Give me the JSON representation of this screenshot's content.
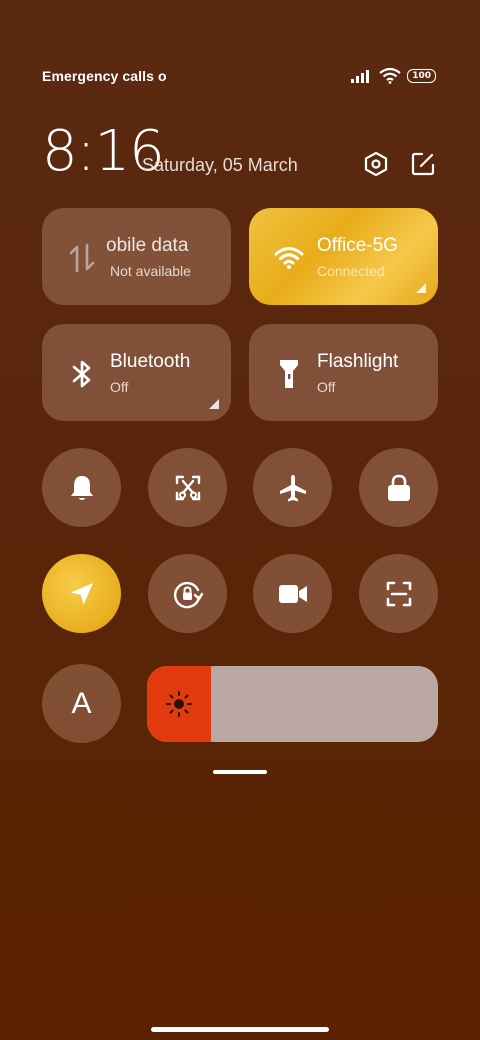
{
  "status_bar": {
    "carrier_text": "Emergency calls o",
    "battery_level": "100",
    "icons": [
      "signal-icon",
      "wifi-icon",
      "battery-icon"
    ]
  },
  "header": {
    "time": "8:16",
    "date": "Saturday, 05 March",
    "icons": [
      "settings-icon",
      "edit-icon"
    ]
  },
  "tiles": {
    "mobile_data": {
      "title": "obile data",
      "subtitle": "Not available",
      "active": false
    },
    "wifi": {
      "title": "Office-5G",
      "subtitle": "Connected",
      "active": true
    },
    "bluetooth": {
      "title": "Bluetooth",
      "subtitle": "Off",
      "active": false
    },
    "flashlight": {
      "title": "Flashlight",
      "subtitle": "Off",
      "active": false
    }
  },
  "toggles_row1": [
    "bell-icon",
    "screenshot-icon",
    "airplane-icon",
    "lock-icon"
  ],
  "toggles_row2": [
    "location-icon",
    "rotation-lock-icon",
    "video-camera-icon",
    "scan-icon"
  ],
  "auto_brightness_label": "A",
  "brightness": {
    "level": 0.22,
    "icon": "sun-icon"
  },
  "colors": {
    "accent": "#efb82a",
    "brightness_fill": "#e23b10",
    "tile_inactive": "#8a5f4e",
    "background": "#5a250c"
  }
}
